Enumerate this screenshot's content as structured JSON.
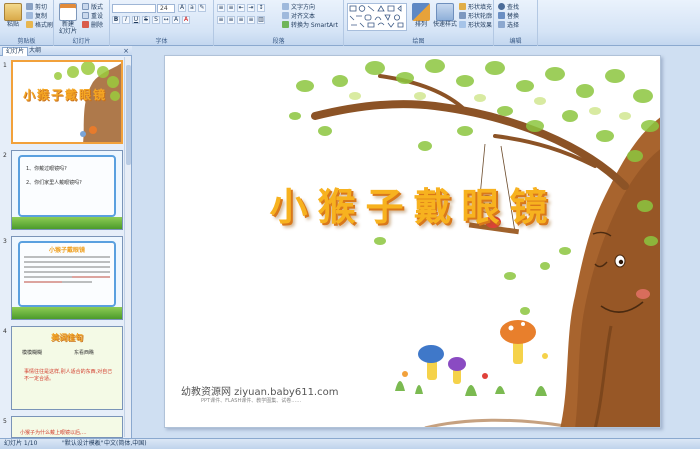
{
  "ribbon": {
    "clipboard": {
      "paste": "粘贴",
      "cut": "剪切",
      "copy": "复制",
      "format_painter": "格式刷",
      "label": "剪贴板"
    },
    "slides": {
      "new_slide": "新建\n幻灯片",
      "layout": "版式",
      "reset": "重设",
      "delete": "删除",
      "label": "幻灯片"
    },
    "font": {
      "font_size": "24",
      "label": "字体"
    },
    "paragraph": {
      "text_direction": "文字方向",
      "align_text": "对齐文本",
      "smartart": "转换为 SmartArt",
      "label": "段落"
    },
    "drawing": {
      "arrange": "排列",
      "quick_styles": "快速样式",
      "shape_fill": "形状填充",
      "shape_outline": "形状轮廓",
      "shape_effects": "形状效果",
      "label": "绘图"
    },
    "editing": {
      "find": "查找",
      "replace": "替换",
      "select": "选择",
      "label": "编辑"
    }
  },
  "panel": {
    "tabs": [
      "幻灯片",
      "大纲"
    ],
    "close": "×",
    "thumbs": [
      {
        "num": "1",
        "title": "小猴子戴眼镜"
      },
      {
        "num": "2",
        "lines": [
          "1、你戴过眼镜吗?",
          "2、你们家里人戴眼镜吗?"
        ]
      },
      {
        "num": "3",
        "title": "小猴子戴眼镜"
      },
      {
        "num": "4",
        "title": "美词佳句",
        "words": [
          "模模糊糊",
          "东看西瞧"
        ],
        "sentence": "事情往往是这样,别人适合的东西,对自己不一定合适。"
      },
      {
        "num": "5",
        "caption": "小猴子为什么戴上眼镜以后,…"
      }
    ]
  },
  "slide": {
    "title": "小猴子戴眼镜",
    "site_name": "幼教资源网 ziyuan.baby611.com",
    "site_sub": "PPT课件、FLASH课件、教学图集、试卷……"
  },
  "status": {
    "slide_pos": "幻灯片 1/10",
    "theme": "\"默认设计模板\"",
    "language": "中文(简体,中国)"
  },
  "colors": {
    "title": "#f7b21f",
    "title_shadow": "#d9781a",
    "ribbon": "#d5e4f6",
    "selected": "#f2a13b"
  }
}
